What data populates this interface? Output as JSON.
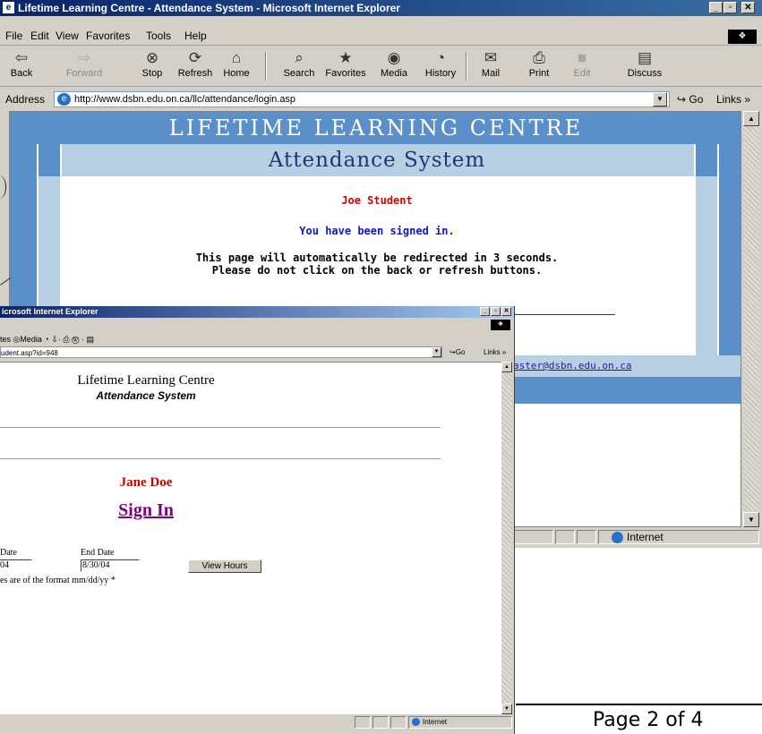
{
  "back_window": {
    "title": "Lifetime Learning Centre - Attendance System - Microsoft Internet Explorer",
    "app_icon": "ie-icon",
    "window_controls": {
      "minimize": "_",
      "maximize": "▫",
      "close": "✕"
    },
    "menu": [
      "File",
      "Edit",
      "View",
      "Favorites",
      "Tools",
      "Help"
    ],
    "toolbar": [
      {
        "label": "Back",
        "icon": "back-arrow-icon",
        "glyph": "⇦",
        "enabled": true
      },
      {
        "label": "Forward",
        "icon": "forward-arrow-icon",
        "glyph": "⇨",
        "enabled": false
      },
      {
        "label": "Stop",
        "icon": "stop-icon",
        "glyph": "⊗",
        "enabled": true
      },
      {
        "label": "Refresh",
        "icon": "refresh-icon",
        "glyph": "⟳",
        "enabled": true
      },
      {
        "label": "Home",
        "icon": "home-icon",
        "glyph": "⌂",
        "enabled": true
      },
      {
        "label": "Search",
        "icon": "search-icon",
        "glyph": "⌕",
        "enabled": true
      },
      {
        "label": "Favorites",
        "icon": "favorites-icon",
        "glyph": "★",
        "enabled": true
      },
      {
        "label": "Media",
        "icon": "media-icon",
        "glyph": "◉",
        "enabled": true
      },
      {
        "label": "History",
        "icon": "history-icon",
        "glyph": "◔",
        "enabled": true
      },
      {
        "label": "Mail",
        "icon": "mail-icon",
        "glyph": "✉",
        "enabled": true
      },
      {
        "label": "Print",
        "icon": "print-icon",
        "glyph": "⎙",
        "enabled": true
      },
      {
        "label": "Edit",
        "icon": "edit-icon",
        "glyph": "■",
        "enabled": false
      },
      {
        "label": "Discuss",
        "icon": "discuss-icon",
        "glyph": "▤",
        "enabled": true
      }
    ],
    "address_label": "Address",
    "address_value": "http://www.dsbn.edu.on.ca/llc/attendance/login.asp",
    "go_label": "Go",
    "links_label": "Links »",
    "page": {
      "banner": "LIFETIME LEARNING CENTRE",
      "subbanner": "Attendance System",
      "student_name": "Joe Student",
      "signed_in_msg": "You have been signed in.",
      "redirect_line1": "This page will automatically be redirected in 3 seconds.",
      "redirect_line2": "Please do not click on the back or refresh buttons.",
      "email_fragment": "aster@dsbn.edu.on.ca"
    },
    "status_zone": "Internet"
  },
  "front_window": {
    "title": "icrosoft Internet Explorer",
    "window_controls": {
      "minimize": "_",
      "maximize": "▫",
      "close": "✕"
    },
    "toolbar_fragment": "tes ◎Media ◔ ⇩· ⎙ Ⓦ · ▤",
    "address_fragment": "udent.asp?id=948",
    "go_label": "Go",
    "links_label": "Links »",
    "page": {
      "title": "Lifetime Learning Centre",
      "subtitle": "Attendance System",
      "student_name": "Jane Doe",
      "sign_in": "Sign In",
      "start_date_label": "Date",
      "start_date_value": "04",
      "end_date_label": "End Date",
      "end_date_value": "8/30/04",
      "view_hours_button": "View Hours",
      "format_note": "es are of the format mm/dd/yy *"
    },
    "status_zone": "Internet"
  },
  "page_footer": "Page 2 of 4",
  "colors": {
    "banner_blue": "#5b8fc9",
    "banner_light": "#b9cfe4",
    "student_red": "#cc0000",
    "signed_in_blue": "#1414c8",
    "sign_in_purple": "#800080"
  }
}
